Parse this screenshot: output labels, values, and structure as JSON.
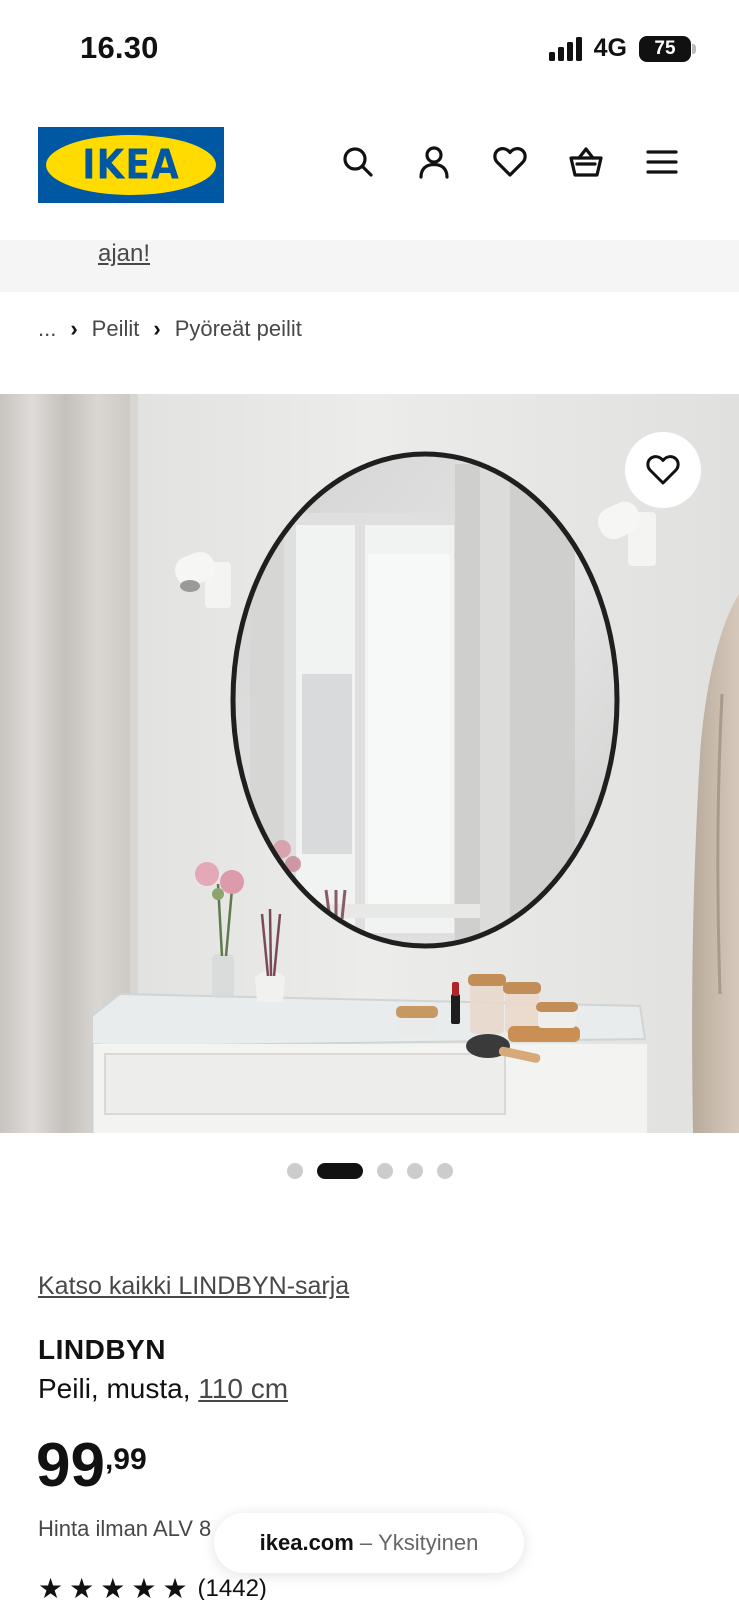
{
  "status_bar": {
    "time": "16.30",
    "network": "4G",
    "battery": "75"
  },
  "header": {
    "logo_text": "IKEA",
    "icons": [
      "search-icon",
      "account-icon",
      "favourites-icon",
      "cart-icon",
      "menu-icon"
    ]
  },
  "banner": {
    "link_text": "ajan!"
  },
  "breadcrumb": {
    "ellipsis": "...",
    "items": [
      "Peilit",
      "Pyöreät peilit"
    ]
  },
  "product": {
    "series_link": "Katso kaikki LINDBYN-sarja",
    "name": "LINDBYN",
    "description": "Peili, musta,",
    "size": "110 cm",
    "price_integer": "99",
    "price_decimal": ",99",
    "vat_text": "Hinta ilman ALV 8",
    "rating_stars": 5,
    "review_count": "(1442)"
  },
  "carousel": {
    "total": 5,
    "active_index": 1
  },
  "browser": {
    "domain": "ikea.com",
    "separator": "–",
    "mode": "Yksityinen"
  },
  "colors": {
    "ikea_blue": "#0058a3",
    "ikea_yellow": "#ffdb00",
    "text": "#111111",
    "muted": "#484848"
  }
}
